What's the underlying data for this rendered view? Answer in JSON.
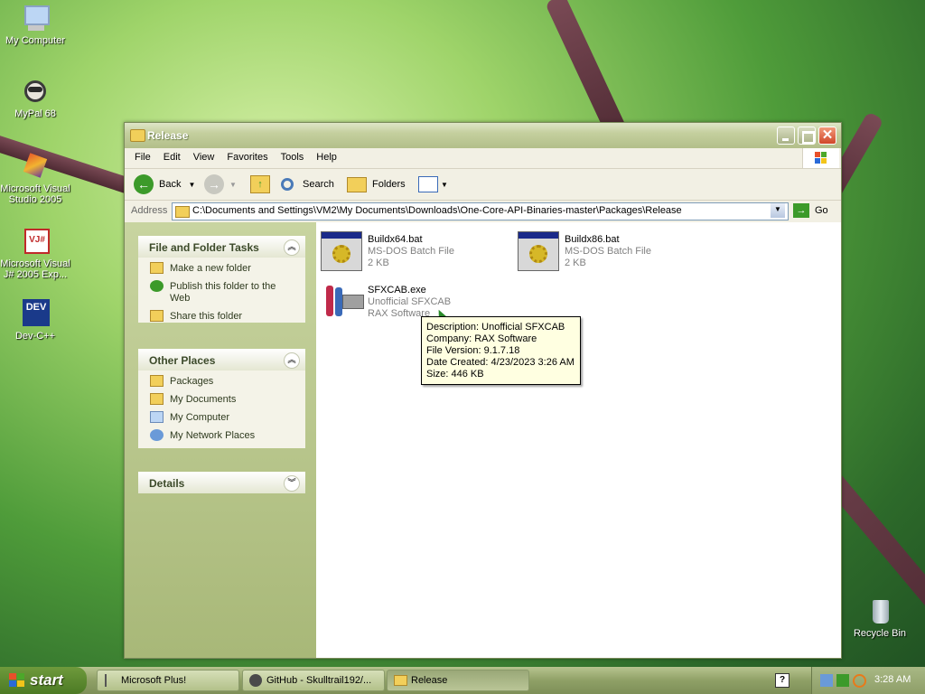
{
  "desktop": {
    "icons": [
      {
        "label": "My Computer",
        "icon": "computer-icon"
      },
      {
        "label": "MyPal 68",
        "icon": "raccoon-icon"
      },
      {
        "label": "Microsoft Visual Studio 2005",
        "icon": "visual-studio-icon"
      },
      {
        "label": "Microsoft Visual J# 2005 Exp...",
        "icon": "vj-icon"
      },
      {
        "label": "Dev-C++",
        "icon": "devcpp-icon"
      },
      {
        "label": "Recycle Bin",
        "icon": "recycle-bin-icon"
      }
    ]
  },
  "window": {
    "title": "Release",
    "menu": [
      "File",
      "Edit",
      "View",
      "Favorites",
      "Tools",
      "Help"
    ],
    "toolbar": {
      "back": "Back",
      "search": "Search",
      "folders": "Folders"
    },
    "address": {
      "label": "Address",
      "path": "C:\\Documents and Settings\\VM2\\My Documents\\Downloads\\One-Core-API-Binaries-master\\Packages\\Release",
      "go": "Go"
    },
    "tasks": {
      "title": "File and Folder Tasks",
      "items": [
        "Make a new folder",
        "Publish this folder to the Web",
        "Share this folder"
      ]
    },
    "other_places": {
      "title": "Other Places",
      "items": [
        "Packages",
        "My Documents",
        "My Computer",
        "My Network Places"
      ]
    },
    "details": {
      "title": "Details"
    },
    "files": [
      {
        "name": "Buildx64.bat",
        "type": "MS-DOS Batch File",
        "size": "2 KB"
      },
      {
        "name": "Buildx86.bat",
        "type": "MS-DOS Batch File",
        "size": "2 KB"
      },
      {
        "name": "SFXCAB.exe",
        "type": "Unofficial SFXCAB",
        "size": "RAX Software"
      }
    ],
    "tooltip": {
      "description": "Description: Unofficial SFXCAB",
      "company": "Company: RAX Software",
      "version": "File Version: 9.1.7.18",
      "created": "Date Created: 4/23/2023 3:26 AM",
      "size": "Size: 446 KB"
    }
  },
  "taskbar": {
    "start": "start",
    "tasks": [
      "Microsoft Plus!",
      "GitHub - Skulltrail192/...",
      "Release"
    ],
    "clock": "3:28 AM"
  }
}
